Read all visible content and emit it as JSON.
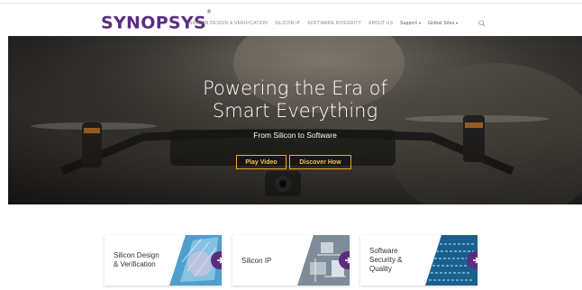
{
  "header": {
    "logo": "SYNOPSYS",
    "logo_mark": "®",
    "nav": [
      {
        "label": "SILICON DESIGN & VERIFICATION"
      },
      {
        "label": "SILICON IP"
      },
      {
        "label": "SOFTWARE INTEGRITY"
      },
      {
        "label": "ABOUT US"
      },
      {
        "label": "Support"
      },
      {
        "label": "Global Sites"
      }
    ],
    "search_icon": "search-icon"
  },
  "hero": {
    "title_line1": "Powering the Era of",
    "title_line2": "Smart Everything",
    "subtitle": "From Silicon to Software",
    "play_video": "Play Video",
    "discover_how": "Discover How",
    "accent": "#f5a623"
  },
  "cards": [
    {
      "label_line1": "Silicon Design",
      "label_line2": "& Verification",
      "arrow_icon": "arrow-right-icon"
    },
    {
      "label_line1": "Silicon IP",
      "arrow_icon": "arrow-right-icon"
    },
    {
      "label_line1": "Software",
      "label_line2": "Security &",
      "label_line3": "Quality",
      "arrow_icon": "arrow-right-icon"
    }
  ],
  "colors": {
    "brand": "#5a2d81",
    "button_border": "#f5a623"
  }
}
